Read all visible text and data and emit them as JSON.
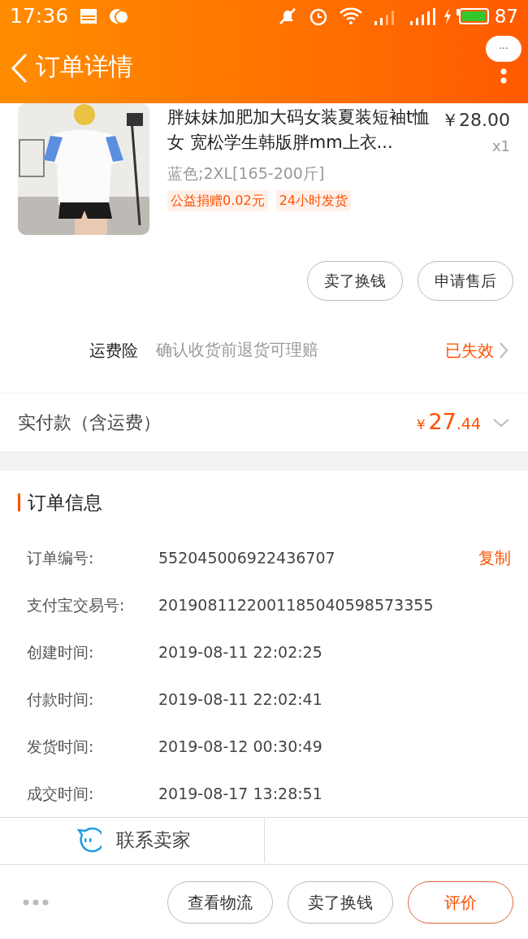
{
  "status_bar": {
    "time": "17:36",
    "battery": "87"
  },
  "header": {
    "title": "订单详情",
    "more_icon": "···"
  },
  "product": {
    "kind": "picture",
    "title": "胖妹妹加肥加大码女装夏装短袖t恤女 宽松学生韩版胖mm上衣...",
    "price": "￥28.00",
    "quantity": "x1",
    "sku": "蓝色;2XL[165-200斤]",
    "tags": [
      "公益捐赠0.02元",
      "24小时发货"
    ]
  },
  "item_buttons": [
    "卖了换钱",
    "申请售后"
  ],
  "insurance": {
    "label": "运费险",
    "description": "确认收货前退货可理赔",
    "status": "已失效"
  },
  "payment": {
    "label": "实付款（含运费）",
    "currency": "￥",
    "integer": "27",
    "decimal": ".44"
  },
  "order_info": {
    "title": "订单信息",
    "copy": "复制",
    "rows": [
      {
        "label": "订单编号:",
        "value": "552045006922436707"
      },
      {
        "label": "支付宝交易号:",
        "value": "2019081122001185040598573355"
      },
      {
        "label": "创建时间:",
        "value": "2019-08-11 22:02:25"
      },
      {
        "label": "付款时间:",
        "value": "2019-08-11 22:02:41"
      },
      {
        "label": "发货时间:",
        "value": "2019-08-12 00:30:49"
      },
      {
        "label": "成交时间:",
        "value": "2019-08-17 13:28:51"
      }
    ]
  },
  "contact": {
    "label": "联系卖家"
  },
  "bottom_bar": {
    "buttons": [
      {
        "label": "查看物流",
        "primary": false
      },
      {
        "label": "卖了换钱",
        "primary": false
      },
      {
        "label": "评价",
        "primary": true
      }
    ]
  }
}
